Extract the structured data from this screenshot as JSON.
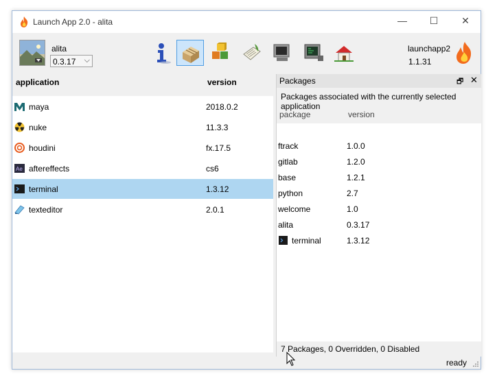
{
  "window": {
    "title": "Launch App 2.0 - alita",
    "minimize_glyph": "—",
    "maximize_glyph": "☐",
    "close_glyph": "✕"
  },
  "user": {
    "name": "alita",
    "version": "0.3.17",
    "version_chevron": "⌵"
  },
  "toolbar_icons": [
    {
      "name": "info-icon",
      "active": false
    },
    {
      "name": "package-icon",
      "active": true
    },
    {
      "name": "blocks-icon",
      "active": false
    },
    {
      "name": "notes-icon",
      "active": false
    },
    {
      "name": "monitor-icon",
      "active": false
    },
    {
      "name": "terminal-monitor-icon",
      "active": false
    },
    {
      "name": "home-icon",
      "active": false
    }
  ],
  "launcher": {
    "name": "launchapp2",
    "version": "1.1.31"
  },
  "applications": {
    "header_app": "application",
    "header_version": "version",
    "rows": [
      {
        "name": "maya",
        "version": "2018.0.2",
        "icon": "maya-icon",
        "selected": false
      },
      {
        "name": "nuke",
        "version": "11.3.3",
        "icon": "nuke-icon",
        "selected": false
      },
      {
        "name": "houdini",
        "version": "fx.17.5",
        "icon": "houdini-icon",
        "selected": false
      },
      {
        "name": "aftereffects",
        "version": "cs6",
        "icon": "aftereffects-icon",
        "selected": false
      },
      {
        "name": "terminal",
        "version": "1.3.12",
        "icon": "terminal-icon",
        "selected": true
      },
      {
        "name": "texteditor",
        "version": "2.0.1",
        "icon": "texteditor-icon",
        "selected": false
      }
    ]
  },
  "packages": {
    "title": "Packages",
    "float_glyph": "🗗",
    "close_glyph": "✕",
    "description": "Packages associated with the currently selected application",
    "header_package": "package",
    "header_version": "version",
    "rows": [
      {
        "name": "ftrack",
        "version": "1.0.0",
        "icon": ""
      },
      {
        "name": "gitlab",
        "version": "1.2.0",
        "icon": ""
      },
      {
        "name": "base",
        "version": "1.2.1",
        "icon": ""
      },
      {
        "name": "python",
        "version": "2.7",
        "icon": ""
      },
      {
        "name": "welcome",
        "version": "1.0",
        "icon": ""
      },
      {
        "name": "alita",
        "version": "0.3.17",
        "icon": ""
      },
      {
        "name": "terminal",
        "version": "1.3.12",
        "icon": "terminal-icon"
      }
    ],
    "summary": "7 Packages, 0 Overridden, 0 Disabled"
  },
  "status": {
    "text": "ready"
  },
  "colors": {
    "selection": "#aed6f1",
    "active_tool_bg": "#cce5fb",
    "active_tool_border": "#4f9de2",
    "flame_orange": "#f26b1d"
  }
}
